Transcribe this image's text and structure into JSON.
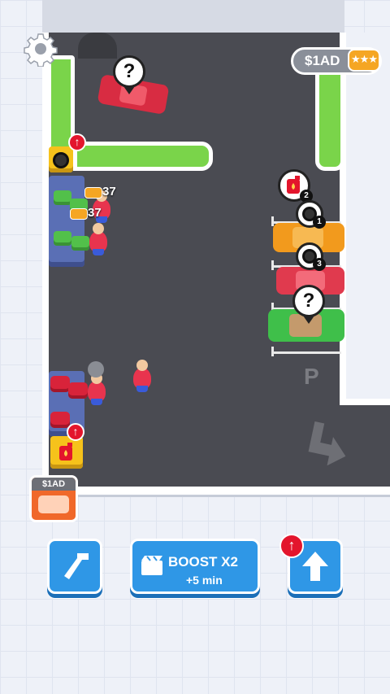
{
  "hud": {
    "cash_pill_label": "$1AD",
    "cash_ticket_glyph": "★★★",
    "settings_icon": "gear-icon"
  },
  "parking": {
    "p_label": "P"
  },
  "customers": [
    {
      "id": "red-sedan-top",
      "request": "?"
    },
    {
      "id": "orange-car",
      "request_icon": "fuel-can-icon",
      "count": "2",
      "tire_count": "1"
    },
    {
      "id": "red-car",
      "tire_count": "3"
    },
    {
      "id": "green-car",
      "request": "?"
    }
  ],
  "stations": {
    "tire_counter_top": "37",
    "tire_counter_bottom": "37"
  },
  "ad_card": {
    "label": "$1AD"
  },
  "toolbar": {
    "build_icon": "hammer-icon",
    "boost_title": "BOOST X2",
    "boost_subtitle": "+5 min",
    "upgrade_icon": "arrow-up-icon",
    "upgrade_badge": "↑"
  },
  "colors": {
    "asphalt": "#4a4b52",
    "grass": "#7ad44a",
    "button_blue": "#2f97e6",
    "accent_red": "#e3152c",
    "ad_orange": "#f0682a"
  }
}
